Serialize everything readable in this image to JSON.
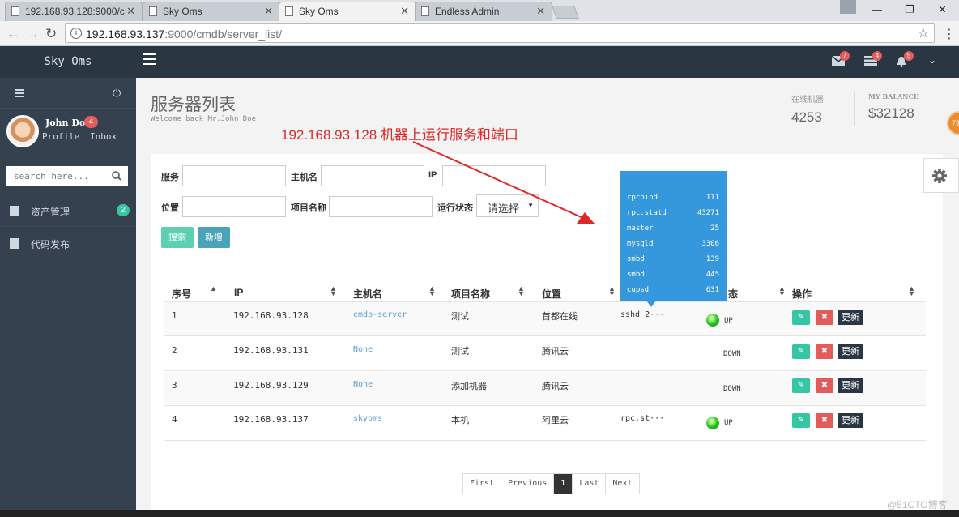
{
  "browser": {
    "tabs": [
      {
        "title": "192.168.93.128:9000/c"
      },
      {
        "title": "Sky Oms"
      },
      {
        "title": "Sky Oms"
      },
      {
        "title": "Endless Admin"
      }
    ],
    "url_host": "192.168.93.137",
    "url_rest": ":9000/cmdb/server_list/"
  },
  "header": {
    "brand": "Sky Oms",
    "mail_count": "7",
    "tasks_count": "4",
    "bell_count": "5"
  },
  "sidebar": {
    "user_name": "John Doe",
    "user_badge": "4",
    "profile_label": "Profile",
    "inbox_label": "Inbox",
    "search_placeholder": "search here...",
    "items": [
      {
        "label": "资产管理",
        "count": "2"
      },
      {
        "label": "代码发布"
      }
    ]
  },
  "page": {
    "title": "服务器列表",
    "subtitle": "Welcome back Mr.John Doe",
    "annotation": "192.168.93.128 机器上运行服务和端口",
    "stats": [
      {
        "label": "在线机器",
        "value": "4253"
      },
      {
        "label": "MY BALANCE",
        "value": "$32128"
      }
    ],
    "orange_badge": "79"
  },
  "filters": {
    "service_label": "服务",
    "hostname_label": "主机名",
    "ip_label": "IP",
    "location_label": "位置",
    "project_label": "项目名称",
    "status_label": "运行状态",
    "status_select": "请选择",
    "search_button": "搜索",
    "add_button": "新增"
  },
  "table": {
    "headers": [
      "序号",
      "IP",
      "主机名",
      "项目名称",
      "位置",
      "态",
      "操作"
    ],
    "rows": [
      {
        "no": "1",
        "ip": "192.168.93.128",
        "host": "cmdb-server",
        "project": "测试",
        "location": "首都在线",
        "services": "sshd 2···",
        "status": "UP"
      },
      {
        "no": "2",
        "ip": "192.168.93.131",
        "host": "None",
        "project": "测试",
        "location": "腾讯云",
        "services": "",
        "status": "DOWN"
      },
      {
        "no": "3",
        "ip": "192.168.93.129",
        "host": "None",
        "project": "添加机器",
        "location": "腾讯云",
        "services": "",
        "status": "DOWN"
      },
      {
        "no": "4",
        "ip": "192.168.93.137",
        "host": "skyoms",
        "project": "本机",
        "location": "阿里云",
        "services": "rpc.st···",
        "status": "UP"
      }
    ],
    "action_edit": "✎",
    "action_delete": "✖",
    "action_update": "更新"
  },
  "tooltip": {
    "rows": [
      {
        "name": "rpcbind",
        "port": "111"
      },
      {
        "name": "rpc.statd",
        "port": "43271"
      },
      {
        "name": "master",
        "port": "25"
      },
      {
        "name": "mysqld",
        "port": "3306"
      },
      {
        "name": "smbd",
        "port": "139"
      },
      {
        "name": "smbd",
        "port": "445"
      },
      {
        "name": "cupsd",
        "port": "631"
      }
    ]
  },
  "pagination": {
    "first": "First",
    "previous": "Previous",
    "current": "1",
    "last": "Last",
    "next": "Next"
  },
  "watermark": "@51CTO博客",
  "colors": {
    "header_bg": "#2b3643",
    "sidebar_bg": "#364150",
    "accent_green": "#36c6a4",
    "danger_red": "#e35b5a",
    "tooltip_blue": "#3598dc",
    "annotation_red": "#e02727"
  }
}
